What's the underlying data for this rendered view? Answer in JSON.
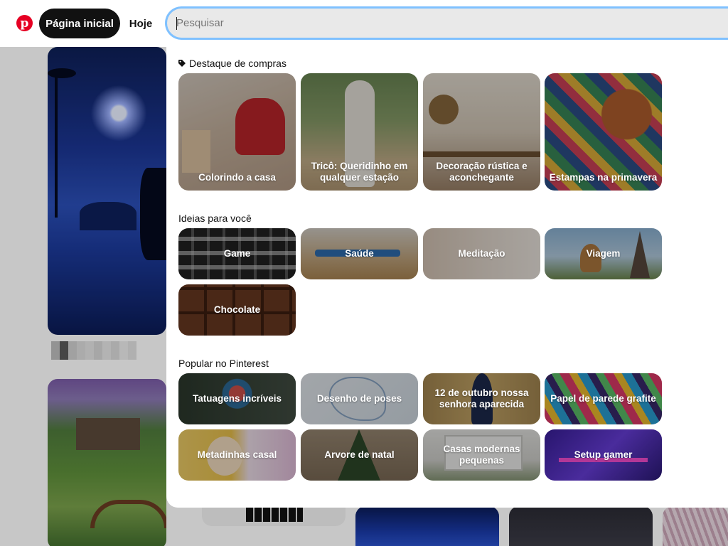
{
  "header": {
    "logo_letter": "p",
    "home_label": "Página inicial",
    "today_label": "Hoje",
    "search_placeholder": "Pesquisar",
    "search_value": ""
  },
  "sections": {
    "shopping": {
      "title": "Destaque de compras",
      "items": [
        {
          "label": "Colorindo a casa"
        },
        {
          "label": "Tricô: Queridinho em qualquer estação"
        },
        {
          "label": "Decoração rústica e aconchegante"
        },
        {
          "label": "Estampas na primavera"
        }
      ]
    },
    "ideas": {
      "title": "Ideias para você",
      "items": [
        {
          "label": "Game"
        },
        {
          "label": "Saúde"
        },
        {
          "label": "Meditação"
        },
        {
          "label": "Viagem"
        },
        {
          "label": "Chocolate"
        }
      ]
    },
    "popular": {
      "title": "Popular no Pinterest",
      "items": [
        {
          "label": "Tatuagens incríveis"
        },
        {
          "label": "Desenho de poses"
        },
        {
          "label": "12 de outubro nossa senhora aparecida"
        },
        {
          "label": "Papel de parede grafite"
        },
        {
          "label": "Metadinhas casal"
        },
        {
          "label": "Arvore de natal"
        },
        {
          "label": "Casas modernas pequenas"
        },
        {
          "label": "Setup gamer"
        }
      ]
    }
  },
  "colors": {
    "brand": "#e60023",
    "focus_ring": "#7fc1ff"
  }
}
